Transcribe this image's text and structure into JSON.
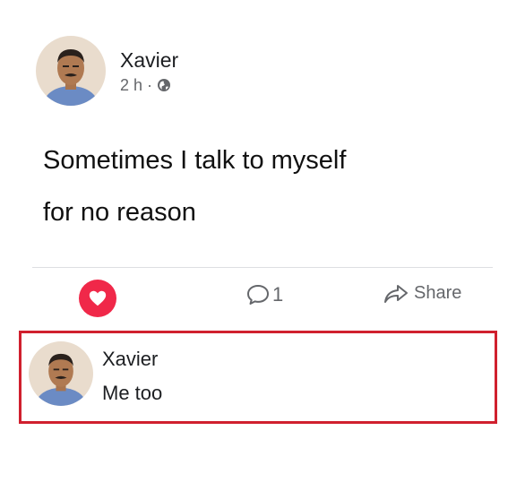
{
  "post": {
    "author": "Xavier",
    "time": "2 h",
    "separator": "·",
    "text_line1": "Sometimes I talk to myself",
    "text_line2": "for no reason"
  },
  "actions": {
    "comment_count": "1",
    "share_label": "Share"
  },
  "comment": {
    "author": "Xavier",
    "text": "Me too"
  },
  "colors": {
    "like_red": "#f02849",
    "highlight_border": "#d0202e",
    "meta_gray": "#65676b"
  },
  "icons": {
    "like": "heart-icon",
    "comment": "comment-bubble-icon",
    "share": "share-arrow-icon",
    "privacy": "globe-icon"
  }
}
